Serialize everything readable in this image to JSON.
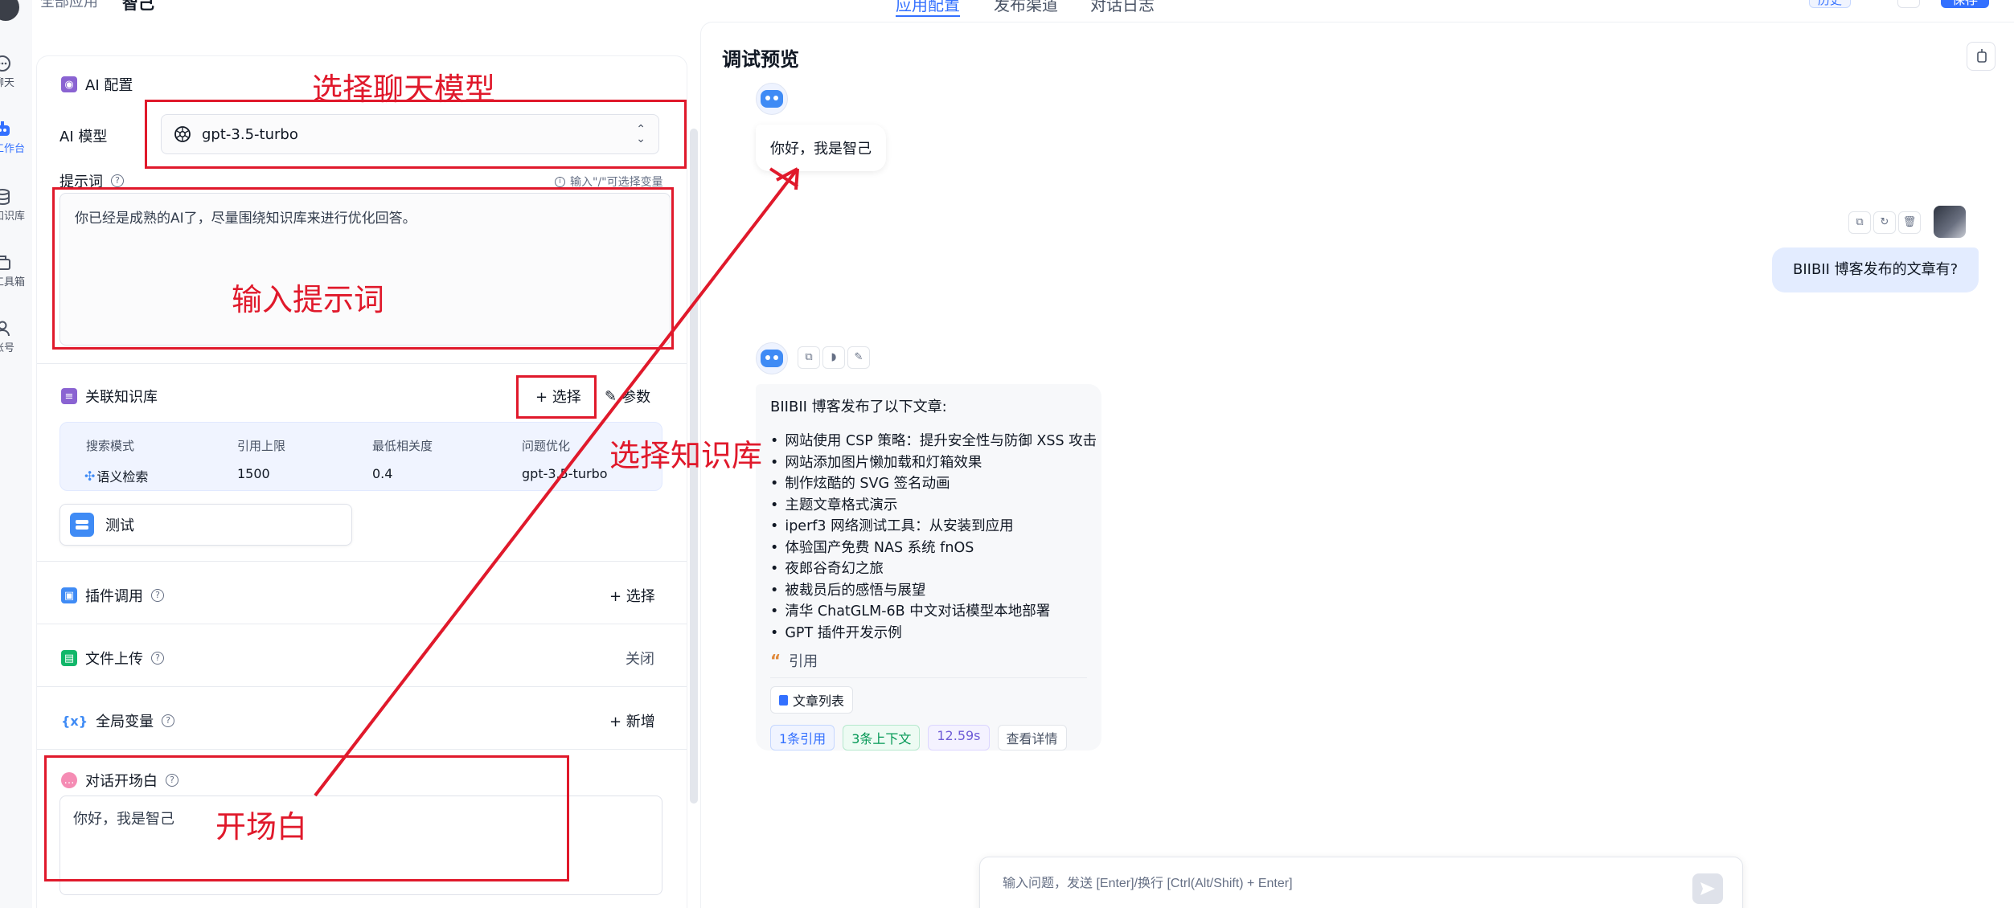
{
  "rail": {
    "items": [
      {
        "icon": "chat-icon",
        "label": "聊天"
      },
      {
        "icon": "robot-icon",
        "label": "工作台"
      },
      {
        "icon": "database-icon",
        "label": "知识库"
      },
      {
        "icon": "toolbox-icon",
        "label": "工具箱"
      },
      {
        "icon": "user-icon",
        "label": "账号"
      }
    ]
  },
  "header": {
    "breadcrumb": "全部应用",
    "app_name": "智己",
    "tabs": [
      "应用配置",
      "发布渠道",
      "对话日志"
    ],
    "version_label": "历史",
    "save_label": "保存"
  },
  "config": {
    "ai_section_title": "AI 配置",
    "model_label": "AI 模型",
    "model_value": "gpt-3.5-turbo",
    "prompt_label": "提示词",
    "prompt_hint": "输入\"/\"可选择变量",
    "prompt_value": "你已经是成熟的AI了，尽量围绕知识库来进行优化回答。",
    "kb_title": "关联知识库",
    "kb_select": "+ 选择",
    "kb_params": "参数",
    "kb_table": {
      "headers": [
        "搜索模式",
        "引用上限",
        "最低相关度",
        "问题优化"
      ],
      "values": [
        "语义检索",
        "1500",
        "0.4",
        "gpt-3.5-turbo"
      ]
    },
    "kb_card_name": "测试",
    "plugin_title": "插件调用",
    "plugin_action": "+ 选择",
    "file_title": "文件上传",
    "file_value": "关闭",
    "vars_title": "全局变量",
    "vars_action": "+ 新增",
    "opening_title": "对话开场白",
    "opening_value": "你好，我是智己"
  },
  "preview": {
    "title": "调试预览",
    "welcome": "你好，我是智己",
    "user_question": "BIIBII 博客发布的文章有?",
    "answer_intro": "BIIBII 博客发布了以下文章:",
    "answer_items": [
      "网站使用 CSP 策略：提升安全性与防御 XSS 攻击",
      "网站添加图片懒加载和灯箱效果",
      "制作炫酷的 SVG 签名动画",
      "主题文章格式演示",
      "iperf3 网络测试工具：从安装到应用",
      "体验国产免费 NAS 系统 fnOS",
      "夜郎谷奇幻之旅",
      "被裁员后的感悟与展望",
      "清华 ChatGLM-6B 中文对话模型本地部署",
      "GPT 插件开发示例"
    ],
    "quote_label": "引用",
    "doc_chip": "文章列表",
    "tags": [
      "1条引用",
      "3条上下文",
      "12.59s",
      "查看详情"
    ],
    "input_placeholder": "输入问题，发送 [Enter]/换行 [Ctrl(Alt/Shift) + Enter]"
  },
  "annotations": {
    "select_model": "选择聊天模型",
    "input_prompt": "输入提示词",
    "select_kb": "选择知识库",
    "opening": "开场白",
    "color": "#e0192b"
  }
}
